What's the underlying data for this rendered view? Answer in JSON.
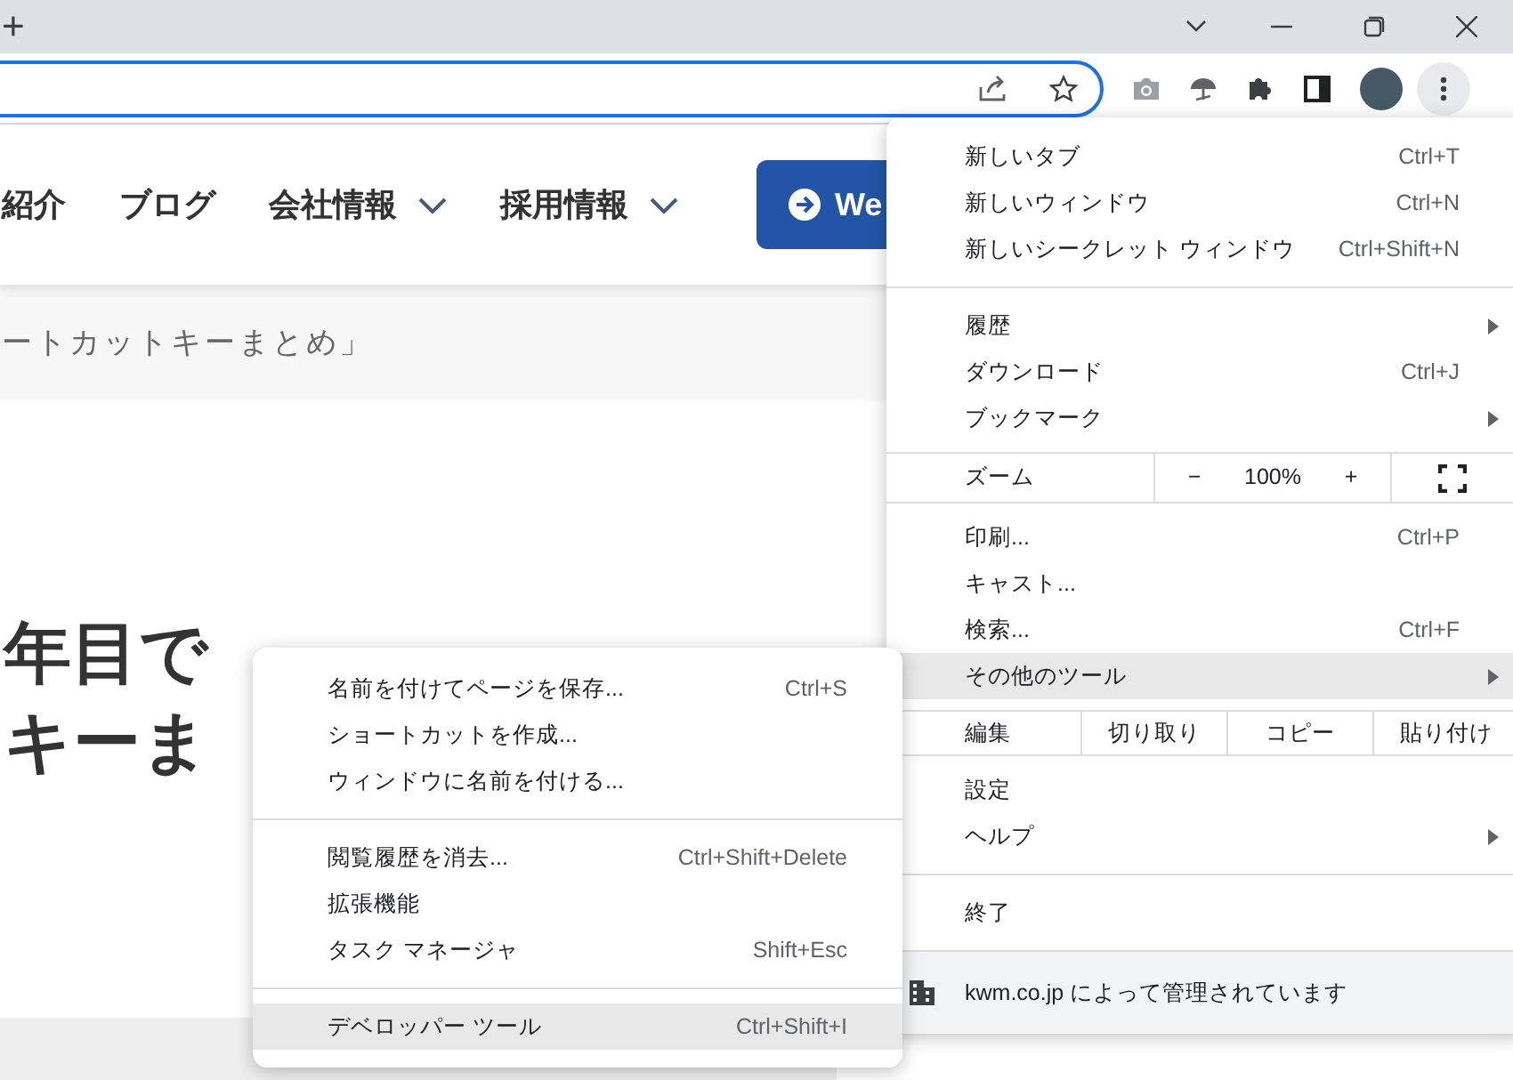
{
  "tab_strip": {
    "new_tab": "+"
  },
  "page": {
    "nav": [
      {
        "label": "紹介",
        "dropdown": false
      },
      {
        "label": "ブログ",
        "dropdown": false
      },
      {
        "label": "会社情報",
        "dropdown": true
      },
      {
        "label": "採用情報",
        "dropdown": true
      }
    ],
    "cta_button": "We",
    "breadcrumb": "ートカットキーまとめ」",
    "heading_lines": [
      "年目で",
      "キーま"
    ]
  },
  "menu": {
    "items": [
      {
        "kind": "item",
        "label": "新しいタブ",
        "shortcut": "Ctrl+T",
        "submenu": false,
        "highlighted": false
      },
      {
        "kind": "item",
        "label": "新しいウィンドウ",
        "shortcut": "Ctrl+N",
        "submenu": false,
        "highlighted": false
      },
      {
        "kind": "item",
        "label": "新しいシークレット ウィンドウ",
        "shortcut": "Ctrl+Shift+N",
        "submenu": false,
        "highlighted": false
      },
      {
        "kind": "separator"
      },
      {
        "kind": "item",
        "label": "履歴",
        "submenu": true,
        "highlighted": false
      },
      {
        "kind": "item",
        "label": "ダウンロード",
        "shortcut": "Ctrl+J",
        "submenu": false,
        "highlighted": false
      },
      {
        "kind": "item",
        "label": "ブックマーク",
        "submenu": true,
        "highlighted": false
      },
      {
        "kind": "zoom",
        "label": "ズーム",
        "minus": "−",
        "value": "100%",
        "plus": "+"
      },
      {
        "kind": "item",
        "label": "印刷...",
        "shortcut": "Ctrl+P",
        "submenu": false,
        "highlighted": false
      },
      {
        "kind": "item",
        "label": "キャスト...",
        "submenu": false,
        "highlighted": false
      },
      {
        "kind": "item",
        "label": "検索...",
        "shortcut": "Ctrl+F",
        "submenu": false,
        "highlighted": false
      },
      {
        "kind": "item",
        "label": "その他のツール",
        "submenu": true,
        "highlighted": true
      },
      {
        "kind": "edit",
        "label": "編集",
        "buttons": [
          "切り取り",
          "コピー",
          "貼り付け"
        ]
      },
      {
        "kind": "item",
        "label": "設定",
        "submenu": false,
        "highlighted": false
      },
      {
        "kind": "item",
        "label": "ヘルプ",
        "submenu": true,
        "highlighted": false
      },
      {
        "kind": "separator"
      },
      {
        "kind": "item",
        "label": "終了",
        "submenu": false,
        "highlighted": false
      },
      {
        "kind": "managed",
        "label": "kwm.co.jp によって管理されています"
      }
    ]
  },
  "submenu": {
    "items": [
      {
        "kind": "item",
        "label": "名前を付けてページを保存...",
        "shortcut": "Ctrl+S",
        "highlighted": false
      },
      {
        "kind": "item",
        "label": "ショートカットを作成...",
        "highlighted": false
      },
      {
        "kind": "item",
        "label": "ウィンドウに名前を付ける...",
        "highlighted": false
      },
      {
        "kind": "separator"
      },
      {
        "kind": "item",
        "label": "閲覧履歴を消去...",
        "shortcut": "Ctrl+Shift+Delete",
        "highlighted": false
      },
      {
        "kind": "item",
        "label": "拡張機能",
        "highlighted": false
      },
      {
        "kind": "item",
        "label": "タスク マネージャ",
        "shortcut": "Shift+Esc",
        "highlighted": false
      },
      {
        "kind": "separator"
      },
      {
        "kind": "item",
        "label": "デベロッパー ツール",
        "shortcut": "Ctrl+Shift+I",
        "highlighted": true
      }
    ]
  }
}
